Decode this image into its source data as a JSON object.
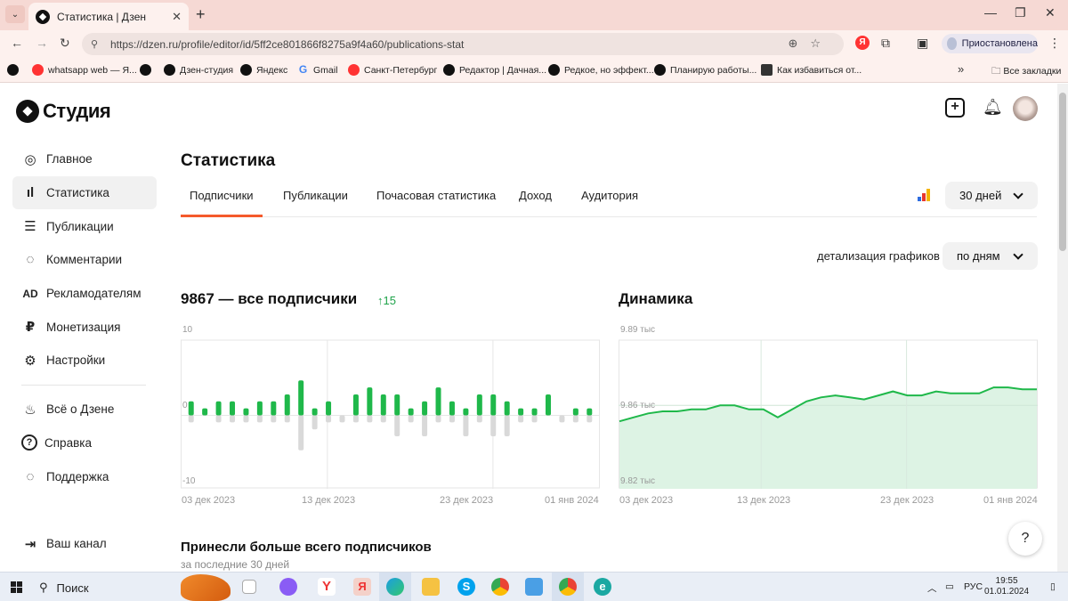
{
  "browser": {
    "tab_title": "Статистика | Дзен",
    "tab_close": "✕",
    "new_tab": "+",
    "url": "https://dzen.ru/profile/editor/id/5ff2ce801866f8275a9f4a60/publications-stat",
    "profile_status": "Приостановлена",
    "bookmarks": [
      {
        "label": "whatsapp web — Я...",
        "icon": "red"
      },
      {
        "label": "",
        "icon": "dark"
      },
      {
        "label": "Дзен-студия",
        "icon": "dark"
      },
      {
        "label": "Яндекс",
        "icon": "dark"
      },
      {
        "label": "Gmail",
        "icon": "google"
      },
      {
        "label": "Санкт-Петербург",
        "icon": "red"
      },
      {
        "label": "Редактор | Дачная...",
        "icon": "dark"
      },
      {
        "label": "Редкое, но эффект...",
        "icon": "dark"
      },
      {
        "label": "Планирую работы...",
        "icon": "dark"
      },
      {
        "label": "Как избавиться от...",
        "icon": "square"
      }
    ],
    "bookmarks_more": "»",
    "all_bookmarks": "Все закладки"
  },
  "studio": {
    "logo": "Студия",
    "nav": [
      {
        "label": "Главное",
        "icon": "planet-icon",
        "glyph": "◎"
      },
      {
        "label": "Статистика",
        "icon": "stats-icon",
        "glyph": "ıl",
        "active": true
      },
      {
        "label": "Публикации",
        "icon": "publications-icon",
        "glyph": "☰"
      },
      {
        "label": "Комментарии",
        "icon": "comment-icon",
        "glyph": "◌"
      },
      {
        "label": "Рекламодателям",
        "icon": "ad-icon",
        "glyph": "AD"
      },
      {
        "label": "Монетизация",
        "icon": "ruble-icon",
        "glyph": "₽"
      },
      {
        "label": "Настройки",
        "icon": "gear-icon",
        "glyph": "⚙"
      }
    ],
    "nav_secondary": [
      {
        "label": "Всё о Дзене",
        "icon": "flame-icon",
        "glyph": "♨"
      },
      {
        "label": "Справка",
        "icon": "question-icon",
        "glyph": "?"
      },
      {
        "label": "Поддержка",
        "icon": "chat-icon",
        "glyph": "◌"
      }
    ],
    "your_channel": "Ваш канал"
  },
  "main": {
    "title": "Статистика",
    "tabs": [
      "Подписчики",
      "Публикации",
      "Почасовая статистика",
      "Доход",
      "Аудитория"
    ],
    "period": "30 дней",
    "detail_label": "детализация графиков",
    "detail_value": "по дням",
    "subscribers_title": "9867 — все подписчики",
    "subscribers_delta": "↑15",
    "dynamics_title": "Динамика",
    "top_section_title": "Принесли больше всего подписчиков",
    "top_section_sub": "за последние 30 дней",
    "help": "?"
  },
  "chart_data": [
    {
      "type": "bar",
      "title": "9867 — все подписчики",
      "ylim": [
        -10,
        10
      ],
      "ytick_labels": [
        "10",
        "0",
        "-10"
      ],
      "x_labels": [
        "03 дек 2023",
        "13 дек 2023",
        "23 дек 2023",
        "01 янв 2024"
      ],
      "series": [
        {
          "name": "gained",
          "color": "#1fb84a",
          "values": [
            2,
            1,
            2,
            2,
            1,
            2,
            2,
            3,
            5,
            1,
            2,
            0,
            3,
            4,
            3,
            3,
            1,
            2,
            4,
            2,
            1,
            3,
            3,
            2,
            1,
            1,
            3,
            0,
            1,
            1
          ]
        },
        {
          "name": "lost",
          "color": "#d9d9d9",
          "values": [
            -1,
            0,
            -1,
            -1,
            -1,
            -1,
            -1,
            -1,
            -5,
            -2,
            -1,
            -1,
            -1,
            -1,
            -1,
            -3,
            -1,
            -3,
            -1,
            -1,
            -3,
            -1,
            -3,
            -3,
            -1,
            -1,
            0,
            -1,
            -1,
            -1
          ]
        }
      ]
    },
    {
      "type": "area",
      "title": "Динамика",
      "ytick_labels": [
        "9.89 тыс",
        "9.86 тыс",
        "9.82 тыс"
      ],
      "ylim": [
        9820,
        9890
      ],
      "x_labels": [
        "03 дек 2023",
        "13 дек 2023",
        "23 дек 2023",
        "01 янв 2024"
      ],
      "color": "#1fb84a",
      "fill": "#ddf3e4",
      "values": [
        9852,
        9854,
        9856,
        9857,
        9857,
        9858,
        9858,
        9860,
        9860,
        9858,
        9858,
        9854,
        9858,
        9862,
        9864,
        9865,
        9864,
        9863,
        9865,
        9867,
        9865,
        9865,
        9867,
        9866,
        9866,
        9866,
        9869,
        9869,
        9868,
        9868
      ]
    }
  ],
  "taskbar": {
    "search": "Поиск",
    "lang": "РУС",
    "time": "19:55",
    "date": "01.01.2024"
  }
}
